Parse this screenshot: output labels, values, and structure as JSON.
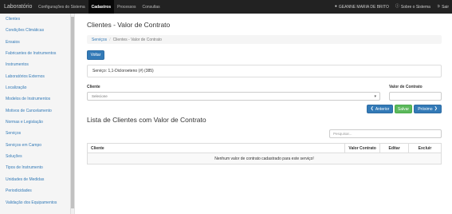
{
  "navbar": {
    "brand": "Laboratório",
    "menu": [
      {
        "label": "Configurações do Sistema",
        "active": false
      },
      {
        "label": "Cadastros",
        "active": true
      },
      {
        "label": "Processos",
        "active": false
      },
      {
        "label": "Consultas",
        "active": false
      }
    ],
    "user_name": "GEANNE MARIA DE BRITO",
    "about_label": "Sobre o Sistema",
    "logout_label": "Sair"
  },
  "sidebar": {
    "items": [
      {
        "label": "Clientes"
      },
      {
        "label": "Condições Climáticas"
      },
      {
        "label": "Ensaios"
      },
      {
        "label": "Fabricantes de Instrumentos"
      },
      {
        "label": "Instrumentos"
      },
      {
        "label": "Laboratórios Externos"
      },
      {
        "label": "Localização"
      },
      {
        "label": "Modelos de Instrumentos"
      },
      {
        "label": "Motivos de Cancelamento"
      },
      {
        "label": "Normas e Legislação"
      },
      {
        "label": "Serviços"
      },
      {
        "label": "Serviços em Campo"
      },
      {
        "label": "Soluções"
      },
      {
        "label": "Tipos de Instrumento"
      },
      {
        "label": "Unidades de Medidas"
      },
      {
        "label": "Periodicidades"
      },
      {
        "label": "Validação dos Equipamentos"
      }
    ]
  },
  "page": {
    "title": "Clientes - Valor de Contrato",
    "breadcrumb": {
      "link": "Serviços",
      "separator": "/",
      "current": "Clientes - Valor de Contrato"
    },
    "back_label": "Voltar",
    "service_info": "Serviço: 1,1-Dicloroeteno (#) (385)",
    "client_label": "Cliente",
    "client_placeholder": "Selecione",
    "contract_value_label": "Valor de Contrato",
    "prev_label": "Anterior",
    "save_label": "Salvar",
    "next_label": "Próximo",
    "list_title": "Lista de Clientes com Valor de Contrato",
    "search_placeholder": "Pesquisar..."
  },
  "table": {
    "columns": [
      "Cliente",
      "Valor Contrato",
      "Editar",
      "Excluir"
    ],
    "empty_message": "Nenhum valor de contrato cadastrado para este serviço!"
  }
}
